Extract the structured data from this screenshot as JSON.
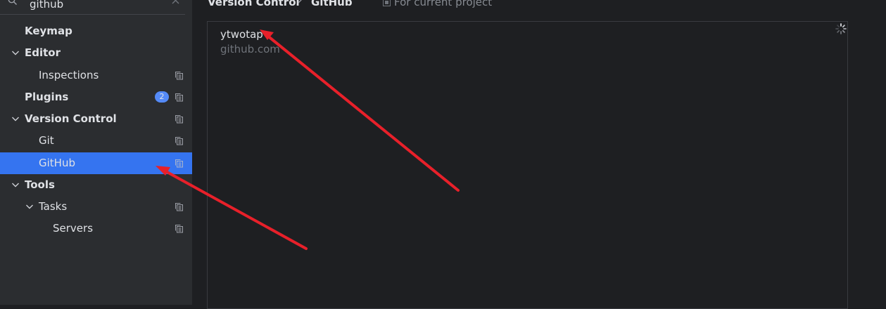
{
  "search": {
    "value": "github"
  },
  "sidebar": {
    "items": [
      {
        "label": "Keymap"
      },
      {
        "label": "Editor"
      },
      {
        "label": "Inspections"
      },
      {
        "label": "Plugins",
        "badge": "2"
      },
      {
        "label": "Version Control"
      },
      {
        "label": "Git"
      },
      {
        "label": "GitHub",
        "selected": true
      },
      {
        "label": "Tools"
      },
      {
        "label": "Tasks"
      },
      {
        "label": "Servers"
      }
    ]
  },
  "breadcrumb": {
    "parent": "Version Control",
    "current": "GitHub",
    "scope": "For current project"
  },
  "accounts": [
    {
      "name": "ytwotap",
      "server": "github.com"
    }
  ],
  "icons": {
    "search": "search-icon",
    "clear": "close-icon",
    "expand": "chevron-down-icon",
    "copy": "copy-icon",
    "separator": "chevron-right-icon",
    "scope": "project-scope-icon",
    "loading": "spinner-icon"
  },
  "colors": {
    "selection": "#3574f0",
    "badge": "#548af7",
    "annotation_arrow": "#e8202a"
  }
}
